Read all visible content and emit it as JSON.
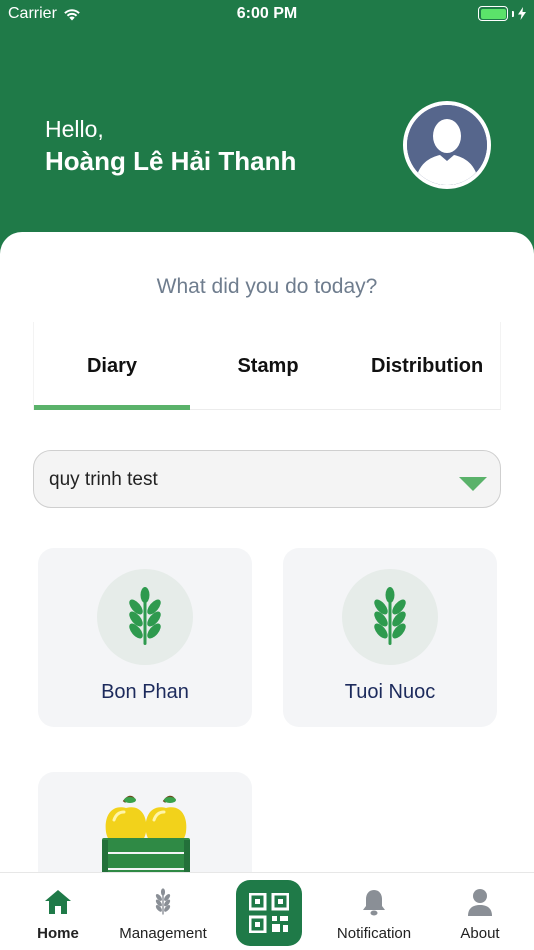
{
  "status_bar": {
    "carrier": "Carrier",
    "time": "6:00 PM"
  },
  "header": {
    "greeting": "Hello,",
    "user_name": "Hoàng Lê Hải Thanh"
  },
  "question": "What did you do today?",
  "tabs": [
    {
      "label": "Diary",
      "active": true
    },
    {
      "label": "Stamp",
      "active": false
    },
    {
      "label": "Distribution",
      "active": false
    }
  ],
  "dropdown": {
    "value": "quy trinh test"
  },
  "tiles": [
    {
      "label": "Bon Phan",
      "icon": "wheat-icon"
    },
    {
      "label": "Tuoi Nuoc",
      "icon": "wheat-icon"
    },
    {
      "label": "",
      "icon": "fruit-crate-icon"
    }
  ],
  "bottom_nav": {
    "home": "Home",
    "management": "Management",
    "notification": "Notification",
    "about": "About"
  },
  "colors": {
    "brand_green": "#1f7a48",
    "accent_green": "#5ab26a",
    "tile_bg": "#f4f5f7",
    "label_navy": "#1c2a5c"
  }
}
